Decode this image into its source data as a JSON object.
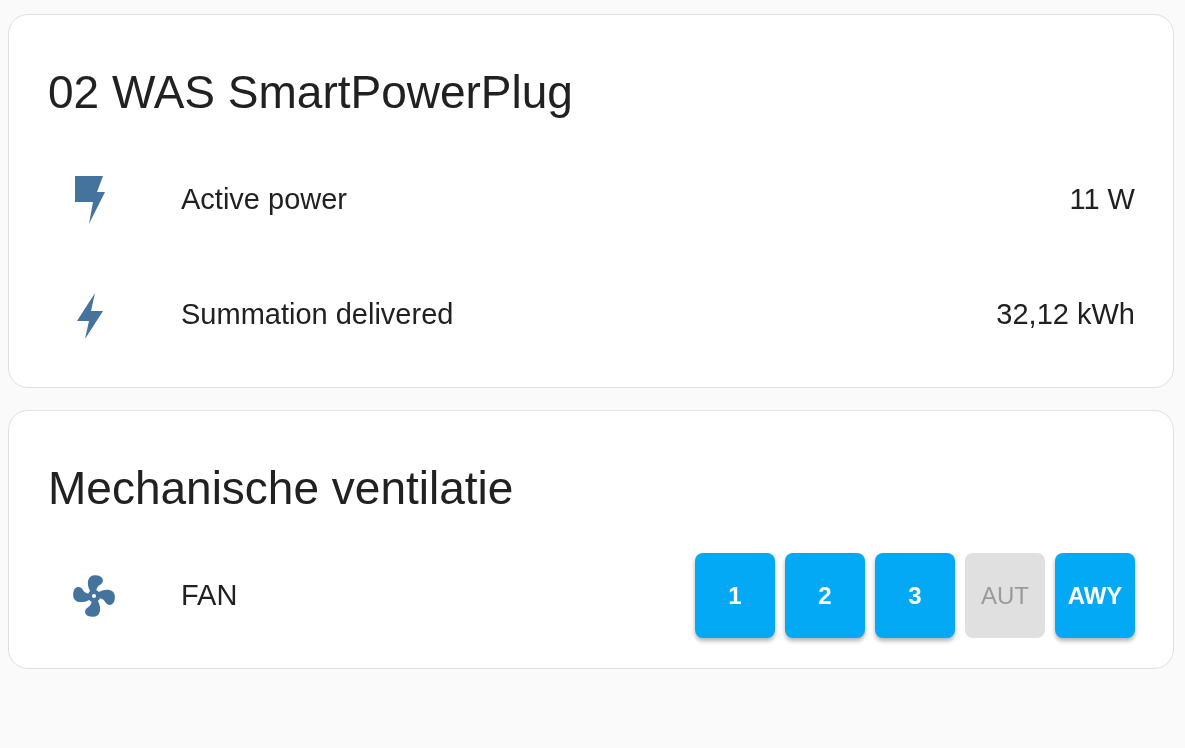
{
  "cards": [
    {
      "title": "02 WAS SmartPowerPlug",
      "rows": [
        {
          "kind": "sensor",
          "label": "Active power",
          "value": "11 W"
        },
        {
          "kind": "sensor",
          "label": "Summation delivered",
          "value": "32,12 kWh"
        }
      ]
    },
    {
      "title": "Mechanische ventilatie",
      "rows": [
        {
          "kind": "buttons",
          "label": "FAN",
          "buttons": [
            {
              "label": "1",
              "disabled": false
            },
            {
              "label": "2",
              "disabled": false
            },
            {
              "label": "3",
              "disabled": false
            },
            {
              "label": "AUT",
              "disabled": true
            },
            {
              "label": "AWY",
              "disabled": false
            }
          ]
        }
      ]
    }
  ]
}
